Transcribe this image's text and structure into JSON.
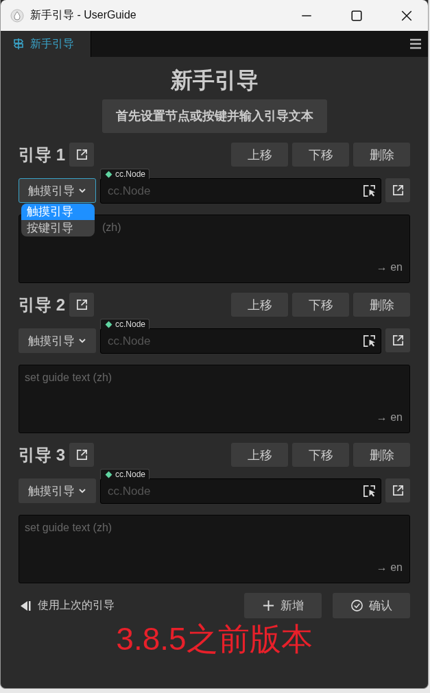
{
  "window": {
    "title": "新手引导 - UserGuide"
  },
  "tabs": [
    {
      "label": "新手引导",
      "selected": true
    }
  ],
  "heading": "新手引导",
  "hint": "首先设置节点或按键并输入引导文本",
  "guides": [
    {
      "title": "引导 1",
      "buttons": [
        "上移",
        "下移",
        "删除"
      ],
      "mode": "触摸引导",
      "dropdown_open": true,
      "options": [
        {
          "label": "触摸引导",
          "selected": true
        },
        {
          "label": "按键引导",
          "selected": false
        }
      ],
      "node_tag": "cc.Node",
      "node_placeholder": "cc.Node",
      "text_placeholder": "(zh)",
      "lang": "→ en"
    },
    {
      "title": "引导 2",
      "buttons": [
        "上移",
        "下移",
        "删除"
      ],
      "mode": "触摸引导",
      "dropdown_open": false,
      "node_tag": "cc.Node",
      "node_placeholder": "cc.Node",
      "text_placeholder": "set guide text (zh)",
      "lang": "→ en"
    },
    {
      "title": "引导 3",
      "buttons": [
        "上移",
        "下移",
        "删除"
      ],
      "mode": "触摸引导",
      "dropdown_open": false,
      "node_tag": "cc.Node",
      "node_placeholder": "cc.Node",
      "text_placeholder": "set guide text (zh)",
      "lang": "→ en"
    }
  ],
  "footer": {
    "use_last": "使用上次的引导",
    "buttons": [
      {
        "kind": "add",
        "label": "新增"
      },
      {
        "kind": "confirm",
        "label": "确认"
      }
    ]
  },
  "annotation": "3.8.5之前版本"
}
